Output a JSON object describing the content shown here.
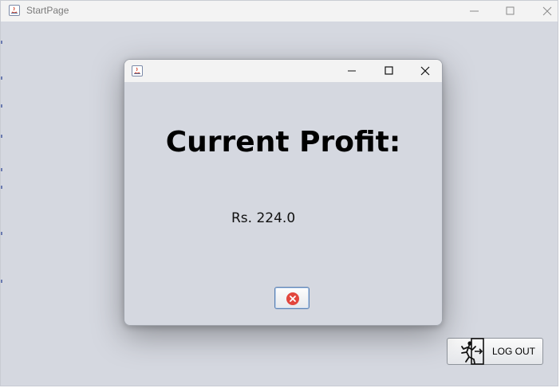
{
  "main_window": {
    "title": "StartPage",
    "controls": {
      "minimize_icon": "minimize-icon",
      "maximize_icon": "maximize-icon",
      "close_icon": "close-icon"
    }
  },
  "dialog": {
    "title": "",
    "heading": "Current Profit:",
    "profit_value": "Rs. 224.0",
    "close_button_icon": "close-circle-icon"
  },
  "logout": {
    "label": "LOG OUT",
    "icon": "exit-running-man-icon"
  },
  "colors": {
    "window_bg": "#d5d8e0",
    "titlebar_bg": "#f3f3f3",
    "close_icon_red": "#e2463d"
  }
}
